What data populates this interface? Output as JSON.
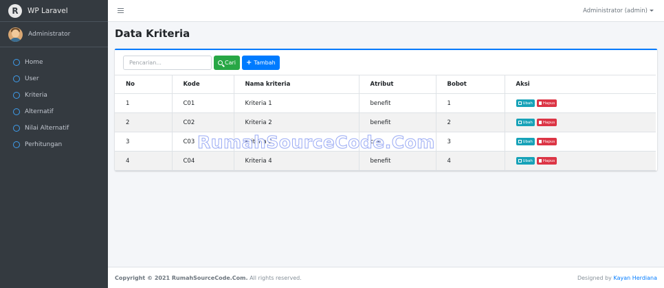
{
  "brand": {
    "title": "WP Laravel",
    "logo_letter": "R"
  },
  "user_panel": {
    "name": "Administrator"
  },
  "sidebar": {
    "items": [
      {
        "label": "Home"
      },
      {
        "label": "User"
      },
      {
        "label": "Kriteria"
      },
      {
        "label": "Alternatif"
      },
      {
        "label": "Nilai Alternatif"
      },
      {
        "label": "Perhitungan"
      }
    ]
  },
  "topbar": {
    "user_menu": "Administrator (admin)"
  },
  "page": {
    "title": "Data Kriteria"
  },
  "toolbar": {
    "search_placeholder": "Pencarian...",
    "search_button": "Cari",
    "add_button": "Tambah"
  },
  "table": {
    "headers": [
      "No",
      "Kode",
      "Nama kriteria",
      "Atribut",
      "Bobot",
      "Aksi"
    ],
    "rows": [
      {
        "no": "1",
        "kode": "C01",
        "nama": "Kriteria 1",
        "atribut": "benefit",
        "bobot": "1"
      },
      {
        "no": "2",
        "kode": "C02",
        "nama": "Kriteria 2",
        "atribut": "benefit",
        "bobot": "2"
      },
      {
        "no": "3",
        "kode": "C03",
        "nama": "Kriteria 3",
        "atribut": "cost",
        "bobot": "3"
      },
      {
        "no": "4",
        "kode": "C04",
        "nama": "Kriteria 4",
        "atribut": "benefit",
        "bobot": "4"
      }
    ],
    "edit_label": "Ubah",
    "delete_label": "Hapus"
  },
  "watermark": "RumahSourceCode.Com",
  "footer": {
    "copyright_prefix": "Copyright © 2021 ",
    "copyright_site": "RumahSourceCode.Com.",
    "copyright_suffix": " All rights reserved.",
    "designed_by": "Designed by ",
    "author": "Kayan Herdiana"
  },
  "colors": {
    "sidebar": "#343a40",
    "primary": "#007bff",
    "success": "#28a745",
    "info": "#17a2b8",
    "danger": "#dc3545"
  }
}
